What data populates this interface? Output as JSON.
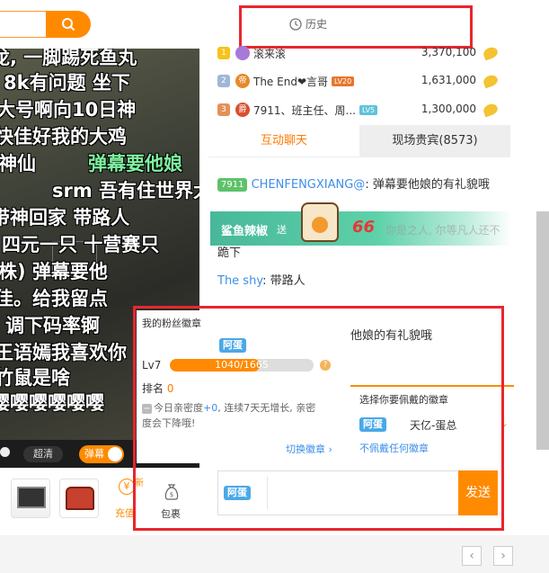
{
  "header": {
    "history_label": "历史"
  },
  "video": {
    "danmaku": [
      "龙, 一脚踢死鱼丸",
      "8k有问题  坐下",
      "大号啊向10日神",
      "快佳好我的大鸡",
      "弹幕要他娘",
      "神仙",
      "srm 吾有住世界大",
      "带神回家    带路人",
      "四元一只  十营赛只",
      "株)    弹幕要他",
      "佳。给我留点",
      "调下码率锕",
      "王语嫣我喜欢你",
      "竹鼠是啥",
      "嘤嘤嘤嘤嘤嘤"
    ],
    "quality_label": "超清",
    "danmu_label": "弹幕"
  },
  "gifts": {
    "recharge_label": "充值",
    "bag_label": "包裹",
    "new_tag": "新"
  },
  "rank": {
    "rows": [
      {
        "place": "1",
        "name": "滚来滚",
        "level": "",
        "score": "3,370,100"
      },
      {
        "place": "2",
        "name": "The End❤言哥",
        "level": "LV20",
        "score": "1,631,000"
      },
      {
        "place": "3",
        "name": "7911、班主任、周...",
        "level": "LV5",
        "score": "1,300,000"
      }
    ]
  },
  "tabs": {
    "chat": "互动聊天",
    "vip": "现场贵宾(8573)"
  },
  "chat": {
    "line1_badge": "7911",
    "line1_user": "CHENFENGXIANG@",
    "line1_msg": ": 弹幕要他娘的有礼貌哦",
    "line2_msg": "跪下",
    "line2_faded": "你是之人, 尔等凡人还不",
    "line3_user": "The shy",
    "line3_msg": ": 带路人",
    "under_popover_msg": "他娘的有礼貌哦"
  },
  "gift_banner": {
    "sender": "鲨鱼辣椒",
    "verb": "送",
    "count": "66"
  },
  "fan_badge": {
    "title": "我的粉丝徽章",
    "badge_name": "阿蛋",
    "level": "Lv7",
    "progress_text": "1040/1665",
    "progress": 0.625,
    "rank_label": "排名",
    "rank_value": "0",
    "note_before": "今日亲密度",
    "note_plus": "+0",
    "note_after": ", 连续7天无增长, 亲密度会下降哦!",
    "switch_label": "切换徽章 ›"
  },
  "badge_select": {
    "title": "选择你要佩戴的徽章",
    "option_badge": "阿蛋",
    "option_name": "天亿-蛋总",
    "none_label": "不佩戴任何徽章"
  },
  "input": {
    "badge": "阿蛋",
    "send_label": "发送"
  },
  "colors": {
    "accent": "#ff8a00",
    "highlight_box": "#e8262d",
    "link_blue": "#3d8ee8"
  }
}
